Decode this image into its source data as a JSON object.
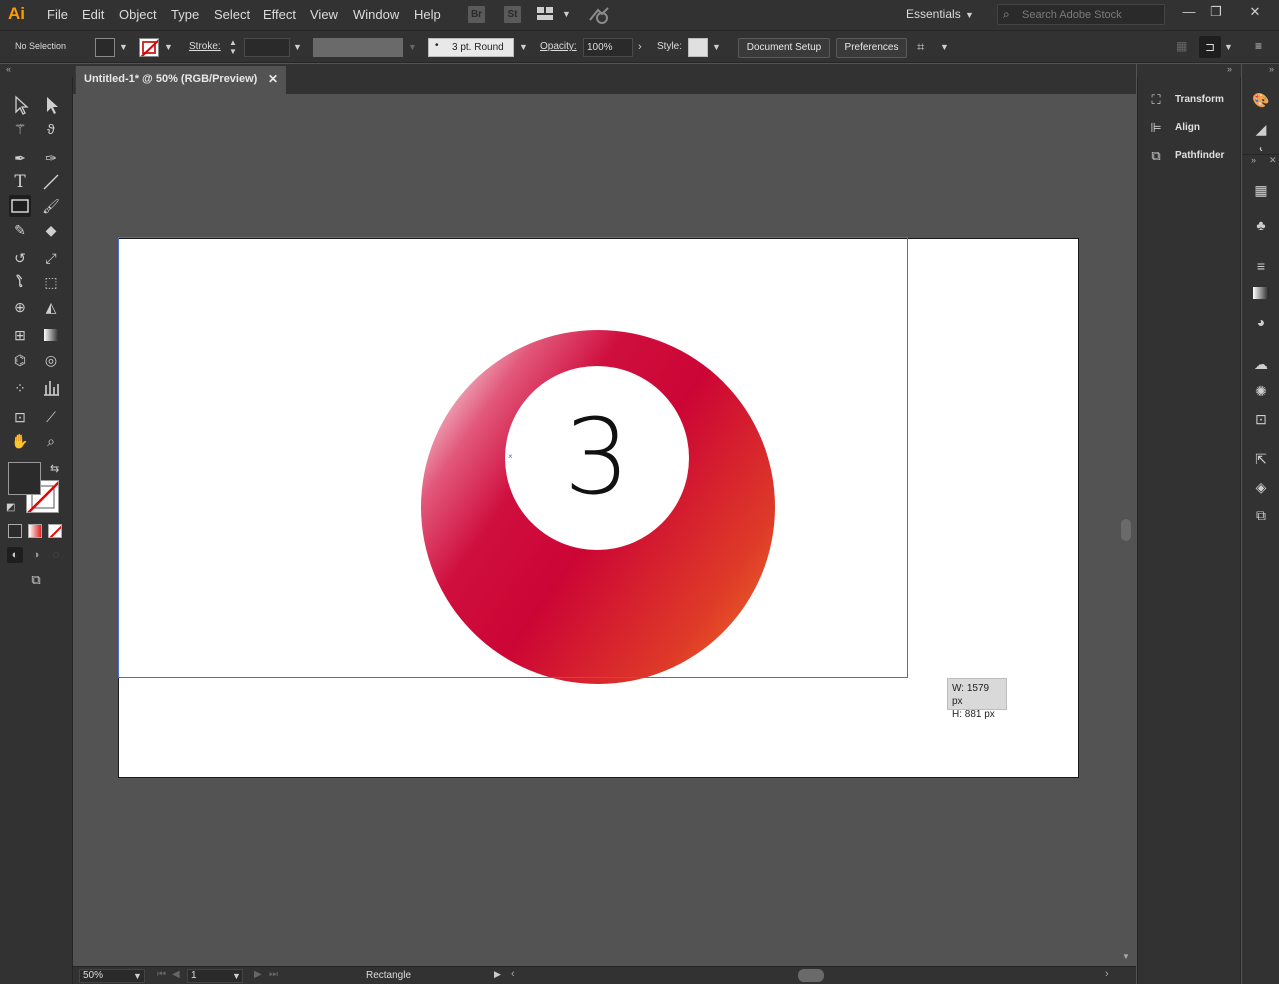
{
  "app": {
    "logo": "Ai",
    "accent_color": "#ff9a00"
  },
  "menubar": {
    "items": [
      "File",
      "Edit",
      "Object",
      "Type",
      "Select",
      "Effect",
      "View",
      "Window",
      "Help"
    ],
    "bridge_label": "Br",
    "stock_label": "St",
    "workspace": "Essentials",
    "search_placeholder": "Search Adobe Stock"
  },
  "controlbar": {
    "selection_status": "No Selection",
    "stroke_label": "Stroke:",
    "brush_value": "3 pt. Round",
    "opacity_label": "Opacity:",
    "opacity_value": "100%",
    "style_label": "Style:",
    "document_setup": "Document Setup",
    "preferences": "Preferences"
  },
  "document": {
    "tab_title": "Untitled-1* @ 50% (RGB/Preview)",
    "tab_close": "✕",
    "ball_number": "3",
    "ball_colors": [
      "#ffffff",
      "#cc0535",
      "#f4772a"
    ],
    "tooltip_w": "W: 1579 px",
    "tooltip_h": "H: 881 px"
  },
  "statusbar": {
    "zoom": "50%",
    "page": "1",
    "status": "Rectangle"
  },
  "panels": {
    "dock_items": [
      {
        "label": "Transform",
        "icon": "transform-icon"
      },
      {
        "label": "Align",
        "icon": "align-icon"
      },
      {
        "label": "Pathfinder",
        "icon": "pathfinder-icon"
      }
    ]
  },
  "tools": [
    "selection-tool",
    "direct-selection-tool",
    "magic-wand-tool",
    "lasso-tool",
    "pen-tool",
    "curvature-tool",
    "type-tool",
    "line-tool",
    "rectangle-tool",
    "paintbrush-tool",
    "shaper-tool",
    "eraser-tool",
    "rotate-tool",
    "scale-tool",
    "warp-tool",
    "free-transform-tool",
    "shape-builder-tool",
    "perspective-grid-tool",
    "mesh-tool",
    "gradient-tool",
    "eyedropper-tool",
    "blend-tool",
    "symbol-sprayer-tool",
    "column-graph-tool",
    "artboard-tool",
    "slice-tool",
    "hand-tool",
    "zoom-tool"
  ]
}
